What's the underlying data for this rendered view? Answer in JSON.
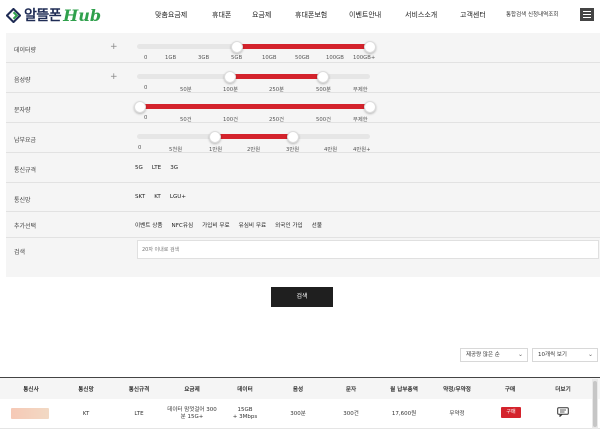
{
  "header": {
    "logo_text": "알뜰폰",
    "logo_hub": "Hub",
    "nav": [
      "맞춤요금제",
      "휴대폰",
      "요금제",
      "휴대폰보험",
      "이벤트안내",
      "서비스소개",
      "고객센터"
    ],
    "util": "통합검색  신청내역조회",
    "icons": {
      "logo": "logo-mark-icon",
      "menu": "hamburger-menu-icon"
    },
    "colors": {
      "brand_navy": "#1f2c55",
      "brand_green": "#2fa04c"
    }
  },
  "filters": {
    "data": {
      "label": "데이터량",
      "ticks": [
        "0",
        "1GB",
        "3GB",
        "5GB",
        "10GB",
        "50GB",
        "100GB",
        "100GB+"
      ],
      "selected_range": [
        "5GB",
        "100GB+"
      ]
    },
    "voice": {
      "label": "음성량",
      "ticks": [
        "0",
        "50분",
        "100분",
        "250분",
        "500분",
        "무제한"
      ],
      "selected_range": [
        "100분",
        "500분"
      ]
    },
    "sms": {
      "label": "문자량",
      "ticks": [
        "0",
        "50건",
        "100건",
        "250건",
        "500건",
        "무제한"
      ],
      "selected_range": [
        "0",
        "무제한"
      ]
    },
    "fee": {
      "label": "납부요금",
      "ticks": [
        "0",
        "5천원",
        "1만원",
        "2만원",
        "3만원",
        "4만원",
        "4만원+"
      ],
      "selected_range": [
        "1만원",
        "3만원"
      ]
    },
    "network": {
      "label": "통신규격",
      "options": [
        "5G",
        "LTE",
        "3G"
      ]
    },
    "carrier": {
      "label": "통신망",
      "options": [
        "SKT",
        "KT",
        "LGU+"
      ]
    },
    "extras": {
      "label": "추가선택",
      "options": [
        "이벤트 상품",
        "NFC유심",
        "가입비 무료",
        "유심비 무료",
        "외국인 가입",
        "선불"
      ]
    },
    "search": {
      "label": "검색",
      "placeholder": "20자 이내로 검색"
    },
    "accent": "#d4232c"
  },
  "search_button": "검색",
  "sort": {
    "order": "제공량 많은 순",
    "page_size": "10개씩 보기"
  },
  "table": {
    "headers": [
      "통신사",
      "통신망",
      "통신규격",
      "요금제",
      "데이터",
      "음성",
      "문자",
      "월 납부총액",
      "약정/무약정",
      "구매",
      "더보기"
    ],
    "rows": [
      {
        "network": "KT",
        "spec": "LTE",
        "plan_line1": "데이터 맘껏걸어 300",
        "plan_line2": "분 15G+",
        "data_line1": "15GB",
        "data_line2": "+ 3Mbps",
        "voice": "300분",
        "sms": "300건",
        "monthly": "17,600원",
        "contract": "무약정",
        "buy_label": "구매",
        "more_icon": "chat-bubble-icon"
      }
    ]
  }
}
